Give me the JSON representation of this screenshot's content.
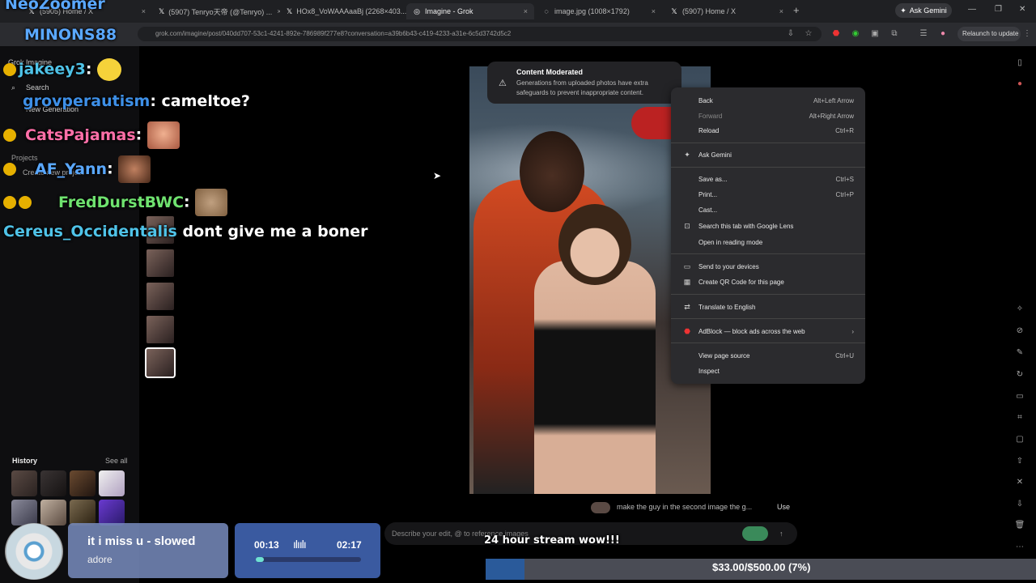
{
  "browser": {
    "tabs": [
      {
        "label": "(5905) Home / X"
      },
      {
        "label": "(5907) Tenryo天帝 (@Tenryo) ..."
      },
      {
        "label": "HOx8_VoWAAAaaBj (2268×403..."
      },
      {
        "label": "Imagine - Grok"
      },
      {
        "label": "image.jpg (1008×1792)"
      },
      {
        "label": "(5907) Home / X"
      }
    ],
    "ask_gemini_label": "Ask Gemini",
    "url": "grok.com/imagine/post/040dd707-53c1-4241-892e-786989f277e8?conversation=a39b6b43-c419-4233-a31e-6c5d3742d5c2",
    "relaunch_label": "Relaunch to update"
  },
  "sidebar": {
    "logo_label": "Grok Imagine",
    "search_label": "Search",
    "new_generation_label": "New Generation",
    "projects_label": "Projects",
    "create_project_label": "Create new project",
    "history_label": "History",
    "see_all_label": "See all"
  },
  "toast": {
    "title": "Content Moderated",
    "body": "Generations from uploaded photos have extra safeguards to prevent inappropriate content."
  },
  "context_menu": {
    "back": {
      "label": "Back",
      "shortcut": "Alt+Left Arrow"
    },
    "forward": {
      "label": "Forward",
      "shortcut": "Alt+Right Arrow"
    },
    "reload": {
      "label": "Reload",
      "shortcut": "Ctrl+R"
    },
    "ask_gemini": {
      "label": "Ask Gemini"
    },
    "save_as": {
      "label": "Save as...",
      "shortcut": "Ctrl+S"
    },
    "print": {
      "label": "Print...",
      "shortcut": "Ctrl+P"
    },
    "cast": {
      "label": "Cast..."
    },
    "lens": {
      "label": "Search this tab with Google Lens"
    },
    "reading_mode": {
      "label": "Open in reading mode"
    },
    "send_devices": {
      "label": "Send to your devices"
    },
    "qr": {
      "label": "Create QR Code for this page"
    },
    "translate": {
      "label": "Translate to English"
    },
    "adblock": {
      "label": "AdBlock — block ads across the web"
    },
    "view_source": {
      "label": "View page source",
      "shortcut": "Ctrl+U"
    },
    "inspect": {
      "label": "Inspect"
    }
  },
  "prompt": {
    "suggestion": "make the guy in the second image the g...",
    "use_label": "Use",
    "placeholder": "Describe your edit, @ to reference images"
  },
  "stream_overlay": {
    "chat": [
      {
        "user": "NeoZoomer",
        "message": ""
      },
      {
        "user": "MINONS88",
        "message": ""
      },
      {
        "user": "jakeey3",
        "message": ""
      },
      {
        "user": "grovperautism",
        "message": "cameltoe?"
      },
      {
        "user": "CatsPajamas",
        "message": ""
      },
      {
        "user": "AF_Yann",
        "message": ""
      },
      {
        "user": "FredDurstBWC",
        "message": ""
      },
      {
        "user": "Cereus_Occidentalis",
        "message": "dont give me a boner"
      }
    ],
    "song_title": "it i miss u - slowed",
    "song_artist": "adore",
    "time_elapsed": "00:13",
    "time_total": "02:17",
    "stream_label": "24 hour stream wow!!!",
    "money_label": "$33.00/$500.00 (7%)",
    "money_progress": 0.07
  },
  "colors": {
    "chat_user_blue": "#5aa8ff",
    "chat_user_pink": "#ff6fa8",
    "chat_user_green": "#6fe26f",
    "chat_user_cyan": "#4fc3e8",
    "money_fill": "#2a5a9a"
  }
}
